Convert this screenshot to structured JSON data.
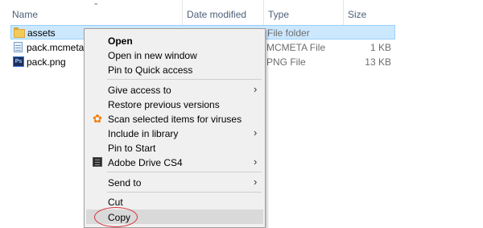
{
  "columns": {
    "name": "Name",
    "date_modified": "Date modified",
    "type": "Type",
    "size": "Size"
  },
  "files": [
    {
      "name": "assets",
      "type": "File folder",
      "size": "",
      "icon": "folder-icon",
      "selected": true
    },
    {
      "name": "pack.mcmeta",
      "type": "MCMETA File",
      "size": "1 KB",
      "icon": "file-icon",
      "selected": false
    },
    {
      "name": "pack.png",
      "type": "PNG File",
      "size": "13 KB",
      "icon": "photoshop-file-icon",
      "selected": false
    }
  ],
  "context_menu": {
    "open": "Open",
    "open_new_window": "Open in new window",
    "pin_quick_access": "Pin to Quick access",
    "give_access": "Give access to",
    "restore_versions": "Restore previous versions",
    "scan_viruses": "Scan selected items for viruses",
    "include_library": "Include in library",
    "pin_start": "Pin to Start",
    "adobe_drive": "Adobe Drive CS4",
    "send_to": "Send to",
    "cut": "Cut",
    "copy": "Copy"
  },
  "colors": {
    "selection_bg": "#cce8ff",
    "menu_bg": "#f0f0f0",
    "annotation_circle": "#d8313b",
    "header_text": "#4c607a"
  }
}
